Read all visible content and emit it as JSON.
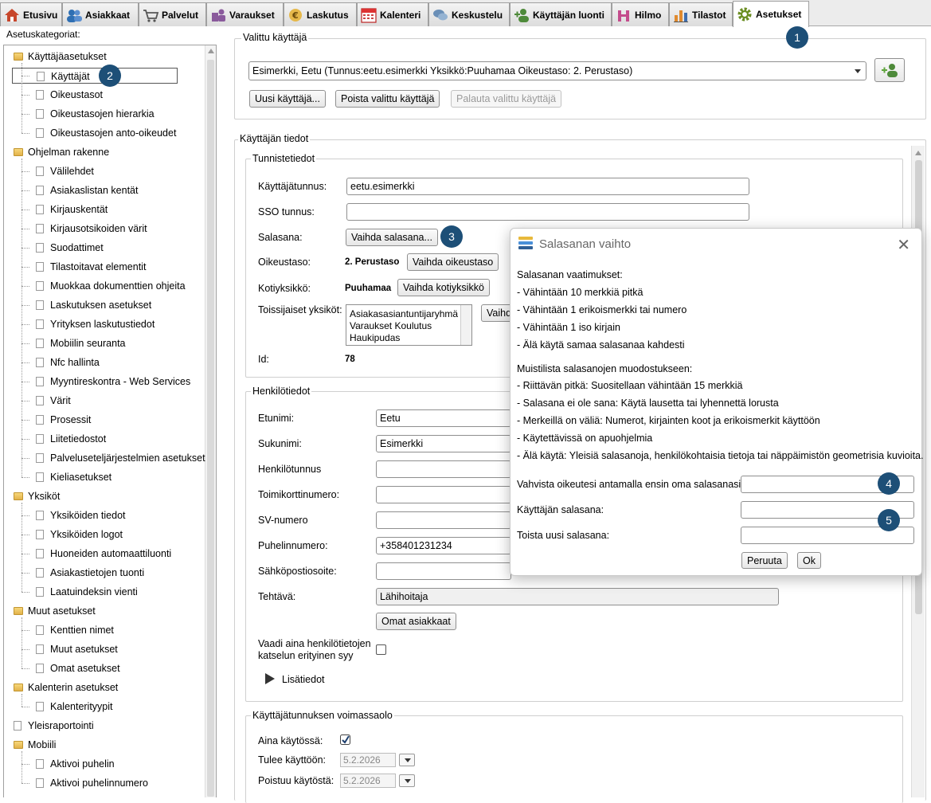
{
  "tabs": [
    {
      "label": "Etusivu",
      "icon": "home-icon"
    },
    {
      "label": "Asiakkaat",
      "icon": "customers-icon"
    },
    {
      "label": "Palvelut",
      "icon": "cart-icon"
    },
    {
      "label": "Varaukset",
      "icon": "reservations-icon"
    },
    {
      "label": "Laskutus",
      "icon": "euro-piggy-icon"
    },
    {
      "label": "Kalenteri",
      "icon": "calendar-icon"
    },
    {
      "label": "Keskustelu",
      "icon": "chat-icon"
    },
    {
      "label": "Käyttäjän luonti",
      "icon": "add-user-icon"
    },
    {
      "label": "Hilmo",
      "icon": "hilmo-icon"
    },
    {
      "label": "Tilastot",
      "icon": "bar-chart-icon"
    },
    {
      "label": "Asetukset",
      "icon": "gear-icon"
    }
  ],
  "left": {
    "title": "Asetuskategoriat:",
    "tree": [
      {
        "label": "Käyttäjäasetukset",
        "type": "folder"
      },
      {
        "label": "Käyttäjät",
        "type": "page",
        "selected": true
      },
      {
        "label": "Oikeustasot",
        "type": "page"
      },
      {
        "label": "Oikeustasojen hierarkia",
        "type": "page"
      },
      {
        "label": "Oikeustasojen anto-oikeudet",
        "type": "page"
      },
      {
        "label": "Ohjelman rakenne",
        "type": "folder"
      },
      {
        "label": "Välilehdet",
        "type": "page"
      },
      {
        "label": "Asiakaslistan kentät",
        "type": "page"
      },
      {
        "label": "Kirjauskentät",
        "type": "page"
      },
      {
        "label": "Kirjausotsikoiden värit",
        "type": "page"
      },
      {
        "label": "Suodattimet",
        "type": "page"
      },
      {
        "label": "Tilastoitavat elementit",
        "type": "page"
      },
      {
        "label": "Muokkaa dokumenttien ohjeita",
        "type": "page"
      },
      {
        "label": "Laskutuksen asetukset",
        "type": "page"
      },
      {
        "label": "Yrityksen laskutustiedot",
        "type": "page"
      },
      {
        "label": "Mobiilin seuranta",
        "type": "page"
      },
      {
        "label": "Nfc hallinta",
        "type": "page"
      },
      {
        "label": "Myyntireskontra - Web Services",
        "type": "page"
      },
      {
        "label": "Värit",
        "type": "page"
      },
      {
        "label": "Prosessit",
        "type": "page"
      },
      {
        "label": "Liitetiedostot",
        "type": "page"
      },
      {
        "label": "Palveluseteljärjestelmien asetukset",
        "type": "page"
      },
      {
        "label": "Kieliasetukset",
        "type": "page"
      },
      {
        "label": "Yksiköt",
        "type": "folder"
      },
      {
        "label": "Yksiköiden tiedot",
        "type": "page"
      },
      {
        "label": "Yksiköiden logot",
        "type": "page"
      },
      {
        "label": "Huoneiden automaattiluonti",
        "type": "page"
      },
      {
        "label": "Asiakastietojen tuonti",
        "type": "page"
      },
      {
        "label": "Laatuindeksin vienti",
        "type": "page"
      },
      {
        "label": "Muut asetukset",
        "type": "folder"
      },
      {
        "label": "Kenttien nimet",
        "type": "page"
      },
      {
        "label": "Muut asetukset",
        "type": "page"
      },
      {
        "label": "Omat asetukset",
        "type": "page"
      },
      {
        "label": "Kalenterin asetukset",
        "type": "folder"
      },
      {
        "label": "Kalenterityypit",
        "type": "page"
      },
      {
        "label": "Yleisraportointi",
        "type": "page-root"
      },
      {
        "label": "Mobiili",
        "type": "folder"
      },
      {
        "label": "Aktivoi puhelin",
        "type": "page"
      },
      {
        "label": "Aktivoi puhelinnumero",
        "type": "page"
      }
    ]
  },
  "selected_user": {
    "legend": "Valittu käyttäjä",
    "value": "Esimerkki, Eetu (Tunnus:eetu.esimerkki Yksikkö:Puuhamaa Oikeustaso: 2. Perustaso)",
    "new_button": "Uusi käyttäjä...",
    "delete_button": "Poista valittu käyttäjä",
    "restore_button": "Palauta valittu käyttäjä"
  },
  "user_info": {
    "legend": "Käyttäjän tiedot",
    "ident": {
      "legend": "Tunnistetiedot",
      "username_label": "Käyttäjätunnus:",
      "username_value": "eetu.esimerkki",
      "sso_label": "SSO tunnus:",
      "sso_value": "",
      "password_label": "Salasana:",
      "password_button": "Vaihda salasana...",
      "level_label": "Oikeustaso:",
      "level_value": "2. Perustaso",
      "level_button": "Vaihda oikeustaso",
      "home_label": "Kotiyksikkö:",
      "home_value": "Puuhamaa",
      "home_button": "Vaihda kotiyksikkö",
      "secondary_label": "Toissijaiset yksiköt:",
      "secondary_units": [
        "Asiakasasiantuntijaryhmä",
        "Varaukset Koulutus",
        "Haukipudas"
      ],
      "secondary_button": "Vaihd",
      "id_label": "Id:",
      "id_value": "78"
    },
    "person": {
      "legend": "Henkilötiedot",
      "first_label": "Etunimi:",
      "first_value": "Eetu",
      "last_label": "Sukunimi:",
      "last_value": "Esimerkki",
      "ssn_label": "Henkilötunnus",
      "card_label": "Toimikorttinumero:",
      "sv_label": "SV-numero",
      "phone_label": "Puhelinnumero:",
      "phone_value": "+358401231234",
      "email_label": "Sähköpostiosoite:",
      "role_label": "Tehtävä:",
      "role_value": "Lähihoitaja",
      "own_clients_button": "Omat asiakkaat",
      "require_reason_label_1": "Vaadi aina henkilötietojen",
      "require_reason_label_2": "katselun erityinen syy",
      "more_label": "Lisätiedot"
    },
    "validity": {
      "legend": "Käyttäjätunnuksen voimassaolo",
      "always_label": "Aina käytössä:",
      "always_checked": true,
      "start_label": "Tulee käyttöön:",
      "start_value": "5.2.2026",
      "end_label": "Poistuu käytöstä:",
      "end_value": "5.2.2026"
    }
  },
  "dialog": {
    "title": "Salasanan vaihto",
    "requirements_title": "Salasanan vaatimukset:",
    "requirements": [
      "- Vähintään 10 merkkiä pitkä",
      "- Vähintään 1 erikoismerkki tai numero",
      "- Vähintään 1 iso kirjain",
      "- Älä käytä samaa salasanaa kahdesti"
    ],
    "tips_title": "Muistilista salasanojen muodostukseen:",
    "tips": [
      "- Riittävän pitkä: Suositellaan vähintään 15 merkkiä",
      "- Salasana ei ole sana: Käytä lausetta tai lyhennettä lorusta",
      "- Merkeillä on väliä: Numerot, kirjainten koot ja erikoismerkit käyttöön",
      "- Käytettävissä on apuohjelmia",
      "- Älä käytä: Yleisiä salasanoja, henkilökohtaisia tietoja tai näppäimistön geometrisia kuvioita."
    ],
    "confirm_label": "Vahvista oikeutesi antamalla ensin oma salasanasi:",
    "new_label": "Käyttäjän salasana:",
    "repeat_label": "Toista uusi salasana:",
    "cancel_button": "Peruuta",
    "ok_button": "Ok"
  },
  "badges": [
    "1",
    "2",
    "3",
    "4",
    "5"
  ],
  "colors": {
    "badge": "#1d4f77"
  }
}
